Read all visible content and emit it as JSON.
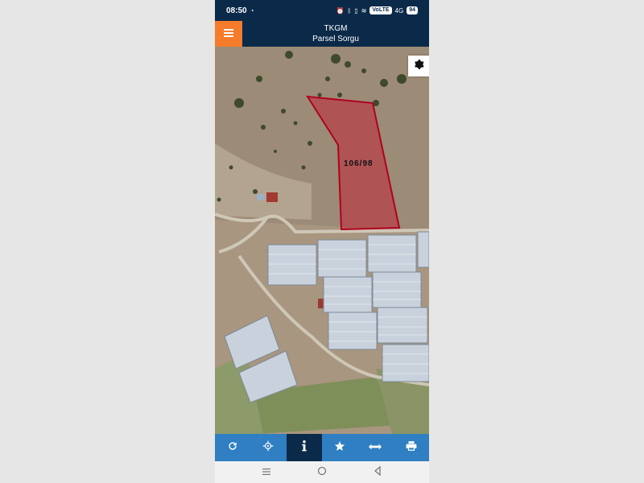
{
  "status_bar": {
    "time": "08:50",
    "battery": "94",
    "network": "VoLTE",
    "signal": "4G"
  },
  "app_bar": {
    "title": "TKGM",
    "subtitle": "Parsel Sorgu",
    "menu_icon": "hamburger-menu-icon",
    "accent_color": "#f47c2a",
    "bar_color": "#0b2a4a"
  },
  "map": {
    "parcel_label": "106/98",
    "parcel_color": "#c8102e",
    "settings_icon": "gear-icon"
  },
  "toolbar": {
    "color": "#2f7fc2",
    "active_color": "#0b2a4a",
    "items": [
      {
        "icon": "refresh-icon",
        "active": false
      },
      {
        "icon": "locate-crosshair-icon",
        "active": false
      },
      {
        "icon": "info-icon",
        "active": true
      },
      {
        "icon": "star-icon",
        "active": false
      },
      {
        "icon": "measure-arrows-icon",
        "active": false
      },
      {
        "icon": "print-icon",
        "active": false
      }
    ]
  },
  "nav_bar": {
    "items": [
      "recent-apps-icon",
      "home-icon",
      "back-icon"
    ]
  }
}
